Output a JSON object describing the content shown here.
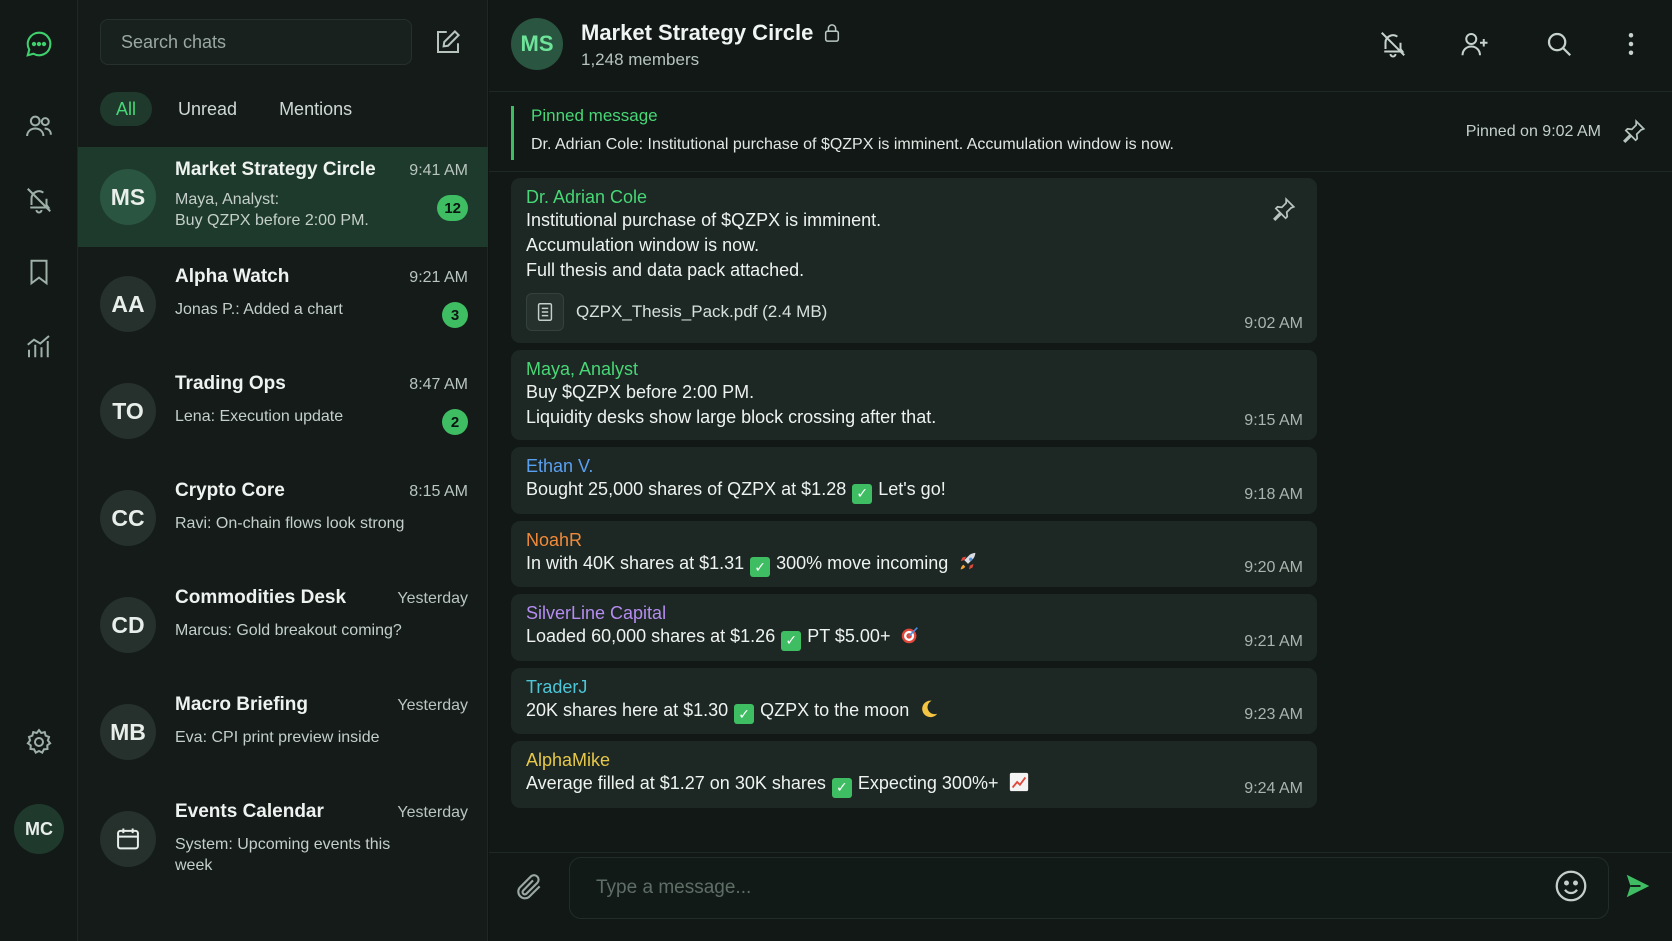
{
  "colors": {
    "accent": "#3ebd62",
    "background": "#111816",
    "active_chat": "#1e3a2c"
  },
  "rail": {
    "items": [
      {
        "icon": "chat-bubble-icon",
        "active": true
      },
      {
        "icon": "contacts-icon"
      },
      {
        "icon": "bell-off-icon"
      },
      {
        "icon": "bookmark-icon"
      },
      {
        "icon": "chart-icon"
      },
      {
        "icon": "gear-icon"
      }
    ],
    "user_initials": "MC"
  },
  "sidebar": {
    "search_placeholder": "Search chats",
    "filters": [
      "All",
      "Unread",
      "Mentions"
    ],
    "chats": [
      {
        "initials": "MS",
        "name": "Market Strategy Circle",
        "time": "9:41 AM",
        "preview_line1": "Maya, Analyst:",
        "preview_line2": "Buy QZPX before 2:00 PM.",
        "badge": "12"
      },
      {
        "initials": "AA",
        "name": "Alpha Watch",
        "time": "9:21 AM",
        "preview": "Jonas P.: Added a chart",
        "badge": "3"
      },
      {
        "initials": "TO",
        "name": "Trading Ops",
        "time": "8:47 AM",
        "preview": "Lena: Execution update",
        "badge": "2"
      },
      {
        "initials": "CC",
        "name": "Crypto Core",
        "time": "8:15 AM",
        "preview": "Ravi: On-chain flows look strong"
      },
      {
        "initials": "CD",
        "name": "Commodities Desk",
        "time": "Yesterday",
        "preview": "Marcus: Gold breakout coming?"
      },
      {
        "initials": "MB",
        "name": "Macro Briefing",
        "time": "Yesterday",
        "preview": "Eva: CPI print preview inside"
      },
      {
        "icon": "calendar-icon",
        "name": "Events Calendar",
        "time": "Yesterday",
        "preview": "System: Upcoming events this week"
      }
    ]
  },
  "header": {
    "initials": "MS",
    "title": "Market Strategy Circle",
    "members": "1,248 members"
  },
  "pinned": {
    "label": "Pinned message",
    "text": "Dr. Adrian Cole: Institutional purchase of $QZPX is imminent. Accumulation window is now.",
    "when": "Pinned on 9:02 AM"
  },
  "messages": [
    {
      "author": "Dr. Adrian Cole",
      "color": "#48d776",
      "lines": [
        "Institutional purchase of $QZPX is imminent.",
        "Accumulation window is now.",
        "Full thesis and data pack attached."
      ],
      "file": "QZPX_Thesis_Pack.pdf (2.4 MB)",
      "time": "9:02 AM"
    },
    {
      "author": "Maya, Analyst",
      "color": "#48d776",
      "lines": [
        "Buy $QZPX before 2:00 PM.",
        "Liquidity desks show large block crossing after that."
      ],
      "time": "9:15 AM"
    },
    {
      "author": "Ethan V.",
      "color": "#5aa0f0",
      "part1": "Bought 25,000 shares of QZPX at $1.28",
      "part2": "Let's go!",
      "time": "9:18 AM"
    },
    {
      "author": "NoahR",
      "color": "#f08a3a",
      "part1": "In with 40K shares at $1.31",
      "part2": "300% move incoming",
      "emoji": "rocket-icon",
      "time": "9:20 AM"
    },
    {
      "author": "SilverLine Capital",
      "color": "#b58cf0",
      "part1": "Loaded 60,000 shares at $1.26",
      "part2": "PT $5.00+",
      "emoji": "target-icon",
      "time": "9:21 AM"
    },
    {
      "author": "TraderJ",
      "color": "#4ec6d8",
      "part1": "20K shares here at $1.30",
      "part2": "QZPX to the moon",
      "emoji": "moon-icon",
      "time": "9:23 AM"
    },
    {
      "author": "AlphaMike",
      "color": "#e6c84a",
      "part1": "Average filled at $1.27 on 30K shares",
      "part2": "Expecting 300%+",
      "emoji": "chart-up-icon",
      "time": "9:24 AM"
    }
  ],
  "composer": {
    "placeholder": "Type a message..."
  }
}
